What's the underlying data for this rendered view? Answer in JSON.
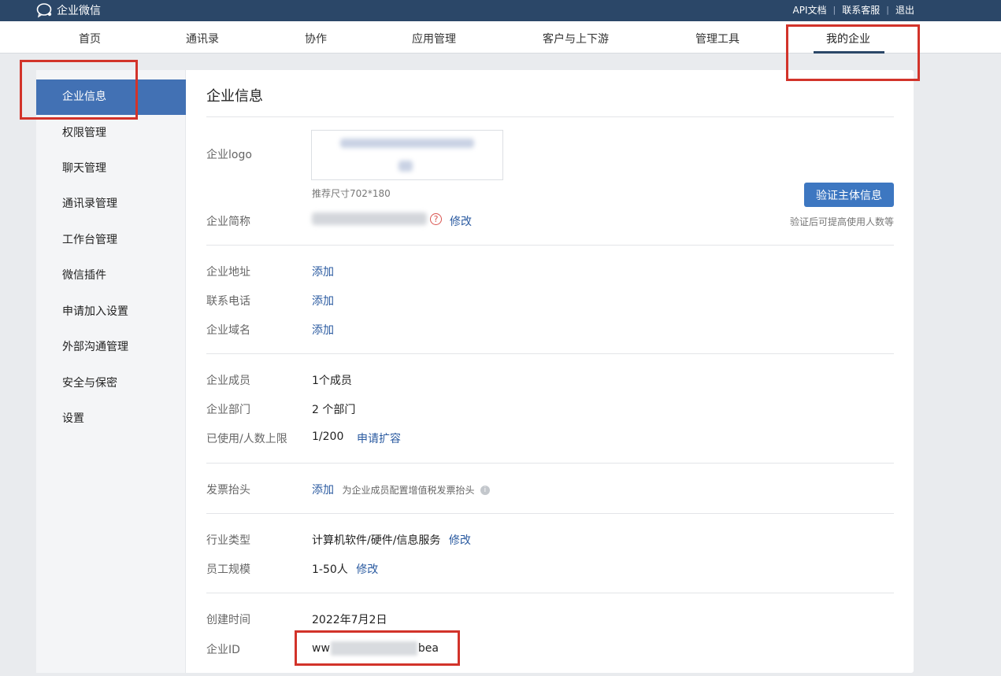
{
  "header": {
    "brand": "企业微信",
    "links": [
      "API文档",
      "联系客服",
      "退出"
    ]
  },
  "nav": {
    "items": [
      "首页",
      "通讯录",
      "协作",
      "应用管理",
      "客户与上下游",
      "管理工具",
      "我的企业"
    ],
    "active_index": 6
  },
  "sidebar": {
    "items": [
      "企业信息",
      "权限管理",
      "聊天管理",
      "通讯录管理",
      "工作台管理",
      "微信插件",
      "申请加入设置",
      "外部沟通管理",
      "安全与保密",
      "设置"
    ],
    "active_index": 0
  },
  "content": {
    "title": "企业信息",
    "logo_label": "企业logo",
    "logo_hint": "推荐尺寸702*180",
    "verify_button": "验证主体信息",
    "verify_hint": "验证后可提高使用人数等",
    "short_name_label": "企业简称",
    "short_name_edit": "修改",
    "address_label": "企业地址",
    "address_action": "添加",
    "phone_label": "联系电话",
    "phone_action": "添加",
    "domain_label": "企业域名",
    "domain_action": "添加",
    "members_label": "企业成员",
    "members_value": "1个成员",
    "departments_label": "企业部门",
    "departments_value": "2 个部门",
    "usage_label": "已使用/人数上限",
    "usage_value": "1/200",
    "usage_action": "申请扩容",
    "invoice_label": "发票抬头",
    "invoice_action": "添加",
    "invoice_hint": "为企业成员配置增值税发票抬头",
    "industry_label": "行业类型",
    "industry_value": "计算机软件/硬件/信息服务",
    "industry_edit": "修改",
    "scale_label": "员工规模",
    "scale_value": "1-50人",
    "scale_edit": "修改",
    "created_label": "创建时间",
    "created_value": "2022年7月2日",
    "corp_id_label": "企业ID",
    "corp_id_prefix": "ww",
    "corp_id_suffix": "bea"
  },
  "colors": {
    "topbar": "#2b4768",
    "accent": "#4271b4",
    "link": "#2a5aa0",
    "annotation": "#d2332a"
  }
}
